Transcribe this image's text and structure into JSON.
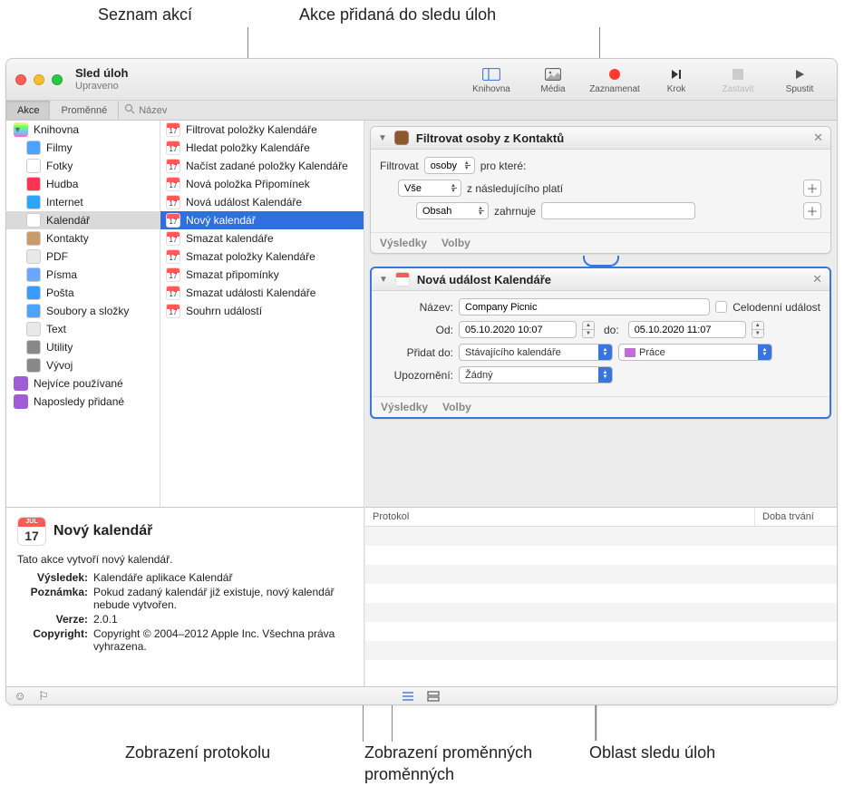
{
  "callouts": {
    "top_left": "Seznam akcí",
    "top_right": "Akce přidaná do sledu úloh",
    "bottom_left": "Zobrazení protokolu",
    "bottom_mid": "Zobrazení proměnných",
    "bottom_right": "Oblast sledu úloh"
  },
  "window": {
    "title": "Sled úloh",
    "subtitle": "Upraveno"
  },
  "toolbar": {
    "library": "Knihovna",
    "media": "Média",
    "record": "Zaznamenat",
    "step": "Krok",
    "stop": "Zastavit",
    "run": "Spustit"
  },
  "filterbar": {
    "actions": "Akce",
    "variables": "Proměnné",
    "search_placeholder": "Název"
  },
  "library": {
    "root": "Knihovna",
    "items": [
      {
        "label": "Filmy",
        "color": "#4aa3ff"
      },
      {
        "label": "Fotky",
        "color": "#ffffff"
      },
      {
        "label": "Hudba",
        "color": "#ff3355"
      },
      {
        "label": "Internet",
        "color": "#2aa6ff"
      },
      {
        "label": "Kalendář",
        "color": "#ffffff",
        "selected": true
      },
      {
        "label": "Kontakty",
        "color": "#c99b6b"
      },
      {
        "label": "PDF",
        "color": "#e8e8e8"
      },
      {
        "label": "Písma",
        "color": "#6aa6ff"
      },
      {
        "label": "Pošta",
        "color": "#3a9bff"
      },
      {
        "label": "Soubory a složky",
        "color": "#4aa3ff"
      },
      {
        "label": "Text",
        "color": "#e8e8e8"
      },
      {
        "label": "Utility",
        "color": "#888888"
      },
      {
        "label": "Vývoj",
        "color": "#888888"
      }
    ],
    "smart": [
      {
        "label": "Nejvíce používané",
        "color": "#a05bd6"
      },
      {
        "label": "Naposledy přidané",
        "color": "#a05bd6"
      }
    ]
  },
  "actions_list": [
    "Filtrovat položky Kalendáře",
    "Hledat položky Kalendáře",
    "Načíst zadané položky Kalendáře",
    "Nová položka Připomínek",
    "Nová událost Kalendáře",
    "Nový kalendář",
    "Smazat kalendáře",
    "Smazat položky Kalendáře",
    "Smazat připomínky",
    "Smazat události Kalendáře",
    "Souhrn událostí"
  ],
  "actions_selected_index": 5,
  "workflow": {
    "filter_action": {
      "title": "Filtrovat osoby z Kontaktů",
      "filter_label": "Filtrovat",
      "filter_subject": "osoby",
      "for_which": "pro které:",
      "all": "Vše",
      "of_following": "z následujícího platí",
      "field": "Obsah",
      "op": "zahrnuje",
      "value": "",
      "results": "Výsledky",
      "options": "Volby"
    },
    "event_action": {
      "title": "Nová událost Kalendáře",
      "name_label": "Název:",
      "name_value": "Company Picnic",
      "allday_label": "Celodenní událost",
      "from_label": "Od:",
      "from_value": "05.10.2020 10:07",
      "to_label": "do:",
      "to_value": "05.10.2020 11:07",
      "addto_label": "Přidat do:",
      "addto_value": "Stávajícího kalendáře",
      "calendar_name": "Práce",
      "calendar_color": "#c56bd6",
      "alert_label": "Upozornění:",
      "alert_value": "Žádný",
      "results": "Výsledky",
      "options": "Volby"
    }
  },
  "info": {
    "title": "Nový kalendář",
    "desc": "Tato akce vytvoří nový kalendář.",
    "result_k": "Výsledek:",
    "result_v": "Kalendáře aplikace Kalendář",
    "note_k": "Poznámka:",
    "note_v": "Pokud zadaný kalendář již existuje, nový kalendář nebude vytvořen.",
    "version_k": "Verze:",
    "version_v": "2.0.1",
    "copyright_k": "Copyright:",
    "copyright_v": "Copyright © 2004–2012 Apple Inc. Všechna práva vyhrazena."
  },
  "log": {
    "col1": "Protokol",
    "col2": "Doba trvání"
  }
}
